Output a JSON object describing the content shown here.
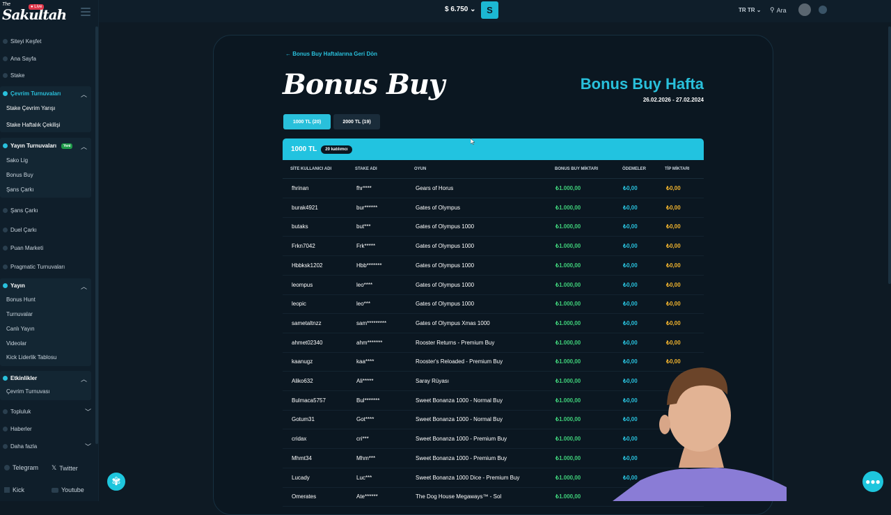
{
  "logo": {
    "the": "The",
    "name": "Sakultah",
    "live_badge": "● Live"
  },
  "topbar": {
    "balance": "$ 6.750 ⌄",
    "wallet_icon": "S",
    "lang": "TR  TR ⌄",
    "search_label": "Ara"
  },
  "sidebar": {
    "items_top": [
      "Siteyi Keşfet",
      "Ana Sayfa",
      "Stake"
    ],
    "group1": {
      "title": "Çevrim Turnuvaları",
      "items": [
        "Stake Çevrim Yarışı",
        "Stake Haftalık Çekilişi"
      ]
    },
    "group2": {
      "title": "Yayın Turnuvaları",
      "badge": "Yeni",
      "items": [
        "Sako Lig",
        "Bonus Buy",
        "Şans Çarkı"
      ]
    },
    "items_mid": [
      "Şans Çarkı",
      "Duel Çarkı",
      "Puan Marketi",
      "Pragmatic Turnuvaları"
    ],
    "group3": {
      "title": "Yayın",
      "items": [
        "Bonus Hunt",
        "Turnuvalar",
        "Canlı Yayın",
        "Videolar",
        "Kick Liderlik Tablosu"
      ]
    },
    "group4": {
      "title": "Etkinlikler",
      "items": [
        "Çevrim Turnuvası"
      ]
    },
    "items_bottom": [
      "Topluluk",
      "Haberler",
      "Daha fazla"
    ],
    "social": [
      "Telegram",
      "Twitter",
      "Kick",
      "Youtube"
    ]
  },
  "page": {
    "back_link": "← Bonus Buy Haftalarına Geri Dön",
    "title": "Bonus Buy",
    "week_title": "Bonus Buy Hafta",
    "week_dates": "26.02.2026 - 27.02.2024",
    "tabs": [
      "1000 TL  (20)",
      "2000 TL  (19)"
    ],
    "table_title": "1000 TL",
    "participants": "20 katılımcı",
    "columns": [
      "SİTE KULLANICI ADI",
      "STAKE ADI",
      "OYUN",
      "BONUS BUY MİKTARI",
      "ÖDEMELER",
      "TİP MİKTARI"
    ]
  },
  "rows": [
    [
      "fhrinan",
      "fhr****",
      "Gears of Horus",
      "₺1.000,00",
      "₺0,00",
      "₺0,00"
    ],
    [
      "burak4921",
      "bur******",
      "Gates of Olympus",
      "₺1.000,00",
      "₺0,00",
      "₺0,00"
    ],
    [
      "butaks",
      "but***",
      "Gates of Olympus 1000",
      "₺1.000,00",
      "₺0,00",
      "₺0,00"
    ],
    [
      "Frkn7042",
      "Frk*****",
      "Gates of Olympus 1000",
      "₺1.000,00",
      "₺0,00",
      "₺0,00"
    ],
    [
      "Hbbksk1202",
      "Hbb*******",
      "Gates of Olympus 1000",
      "₺1.000,00",
      "₺0,00",
      "₺0,00"
    ],
    [
      "leompus",
      "leo****",
      "Gates of Olympus 1000",
      "₺1.000,00",
      "₺0,00",
      "₺0,00"
    ],
    [
      "leopic",
      "leo***",
      "Gates of Olympus 1000",
      "₺1.000,00",
      "₺0,00",
      "₺0,00"
    ],
    [
      "sametaltnzz",
      "sam*********",
      "Gates of Olympus Xmas 1000",
      "₺1.000,00",
      "₺0,00",
      "₺0,00"
    ],
    [
      "ahmet02340",
      "ahm*******",
      "Rooster Returns - Premium Buy",
      "₺1.000,00",
      "₺0,00",
      "₺0,00"
    ],
    [
      "kaanugz",
      "kaa****",
      "Rooster's Reloaded - Premium Buy",
      "₺1.000,00",
      "₺0,00",
      "₺0,00"
    ],
    [
      "Aliko632",
      "Ali*****",
      "Saray Rüyası",
      "₺1.000,00",
      "₺0,00",
      ""
    ],
    [
      "Bulmaca5757",
      "Bul*******",
      "Sweet Bonanza 1000 - Normal Buy",
      "₺1.000,00",
      "₺0,00",
      ""
    ],
    [
      "Gotum31",
      "Got****",
      "Sweet Bonanza 1000 - Normal Buy",
      "₺1.000,00",
      "₺0,00",
      ""
    ],
    [
      "cridax",
      "cri***",
      "Sweet Bonanza 1000 - Premium Buy",
      "₺1.000,00",
      "₺0,00",
      ""
    ],
    [
      "Mhmt34",
      "Mhm***",
      "Sweet Bonanza 1000 - Premium Buy",
      "₺1.000,00",
      "₺0,00",
      ""
    ],
    [
      "Lucady",
      "Luc***",
      "Sweet Bonanza 1000 Dice - Premium Buy",
      "₺1.000,00",
      "₺0,00",
      ""
    ],
    [
      "Omerates",
      "Ate******",
      "The Dog House Megaways™ - Sol",
      "₺1.000,00",
      "",
      ""
    ]
  ]
}
